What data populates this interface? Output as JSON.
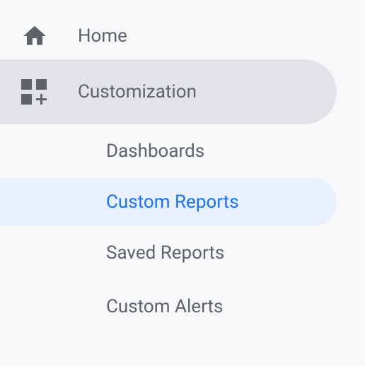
{
  "nav": {
    "home": {
      "label": "Home"
    },
    "customization": {
      "label": "Customization",
      "children": {
        "dashboards": {
          "label": "Dashboards"
        },
        "custom_reports": {
          "label": "Custom Reports"
        },
        "saved_reports": {
          "label": "Saved Reports"
        },
        "custom_alerts": {
          "label": "Custom Alerts"
        }
      }
    }
  }
}
